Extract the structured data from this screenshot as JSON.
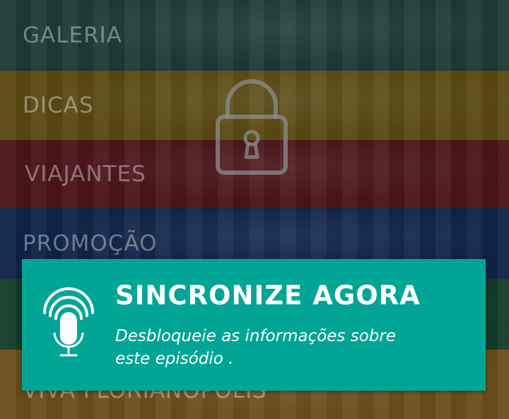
{
  "menu": {
    "items": [
      {
        "label": "GALERIA"
      },
      {
        "label": "DICAS"
      },
      {
        "label": "VIAJANTES"
      },
      {
        "label": "PROMOÇÃO"
      },
      {
        "label": ""
      },
      {
        "label": "VIVA FLORIANÓPOLIS"
      }
    ],
    "band_colors": [
      "#1d3b35",
      "#5a4a12",
      "#4a1417",
      "#0f2449",
      "#143d2b",
      "#6b4f1a"
    ]
  },
  "overlay": {
    "icon": "lock-icon",
    "title": "SINCRONIZE AGORA",
    "subtitle_line1": "Desbloqueie as informações sobre",
    "subtitle_line2": "este episódio .",
    "card_icon": "microphone-broadcast-icon",
    "accent_color": "#00a596"
  }
}
